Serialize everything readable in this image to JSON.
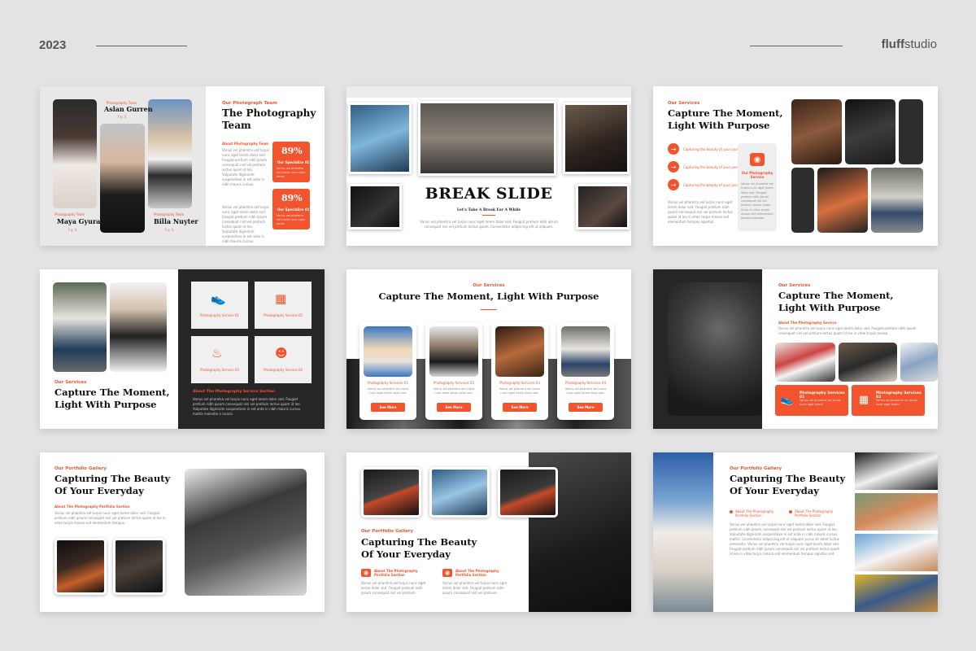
{
  "header": {
    "year": "2023",
    "brand_bold": "fluff",
    "brand_light": "studio"
  },
  "colors": {
    "accent": "#f2542d",
    "dark": "#262626",
    "background": "#e3e3e3"
  },
  "slide1": {
    "kicker": "Our Photograph Team",
    "title_l1": "The Photography",
    "title_l2": "Team",
    "about": "About Photography Team",
    "body": "Varius vel pharetra vel turpis nunc eget lorem dolor sed. Feugiat pretium nibh ipsum consequat nisl vel pretium lectus quam id leo. Vulputate dignissim suspendisse in est ante in nibh mauris cursus.",
    "stat1": {
      "value": "89%",
      "label": "Our Specialize 01",
      "text": "Varius vel pharetra vel turpis nunc eget lorem"
    },
    "stat2": {
      "value": "89%",
      "label": "Our Specialize 01",
      "text": "Varius vel pharetra vel turpis nunc eget lorem"
    },
    "member_top": {
      "role": "Photography Team",
      "name": "Aslan Gurren"
    },
    "member_left": {
      "role": "Photography Team",
      "name": "Maya Gyura"
    },
    "member_right": {
      "role": "Photography Team",
      "name": "Billa Nuyter"
    },
    "social": "f ◎ 𝕏"
  },
  "slide2": {
    "title": "BREAK SLIDE",
    "subtitle": "Let's Take A Break For A While",
    "body": "Varius vel pharetra vel turpis nunc eget lorem dolor sed. Feugiat pretium nibh ipsum consequat nisl vel pretium lectus quam. Consectetur adipiscing elit ut aliquam."
  },
  "slide3": {
    "kicker": "Our Services",
    "title_l1": "Capture The Moment,",
    "title_l2": "Light With Purpose",
    "items": [
      "Capturing the beauty of your journey",
      "Capturing the beauty of your journey",
      "Capturing the beauty of your journey"
    ],
    "service_label": "Our Photography Service",
    "body": "Varius vel pharetra vel turpis nunc eget lorem dolor sed. Feugiat pretium nibh ipsum consequat nisl vel pretium lectus quam id leo in vitae turpis massa sed elementum tempus egestas."
  },
  "slide4": {
    "kicker": "Our Services",
    "title_l1": "Capture The Moment,",
    "title_l2": "Light With Purpose",
    "services": [
      "Photography Service 01",
      "Photography Service 02",
      "Photography Service 03",
      "Photography Service 04"
    ],
    "section_title": "About The Photography Service Section",
    "body": "Varius vel pharetra vel turpis nunc eget lorem dolor sed. Feugiat pretium nibh ipsum consequat nisl vel pretium lectus quam id leo. Vulputate dignissim suspendisse in est ante in nibh mauris cursus mattis molestie a iaculis."
  },
  "slide5": {
    "kicker": "Our Services",
    "title": "Capture The Moment, Light With Purpose",
    "cards": [
      {
        "label": "Photography Services 01",
        "text": "Varius vel pharetra vel turpis nunc eget lorem dolor sed.",
        "button": "See More"
      },
      {
        "label": "Photography Services 02",
        "text": "Varius vel pharetra vel turpis nunc eget lorem dolor sed.",
        "button": "See More"
      },
      {
        "label": "Photography Services 03",
        "text": "Varius vel pharetra vel turpis nunc eget lorem dolor sed.",
        "button": "See More"
      },
      {
        "label": "Photography Services 04",
        "text": "Varius vel pharetra vel turpis nunc eget lorem dolor sed.",
        "button": "See More"
      }
    ]
  },
  "slide6": {
    "kicker": "Our Services",
    "title_l1": "Capture The Moment,",
    "title_l2": "Light With Purpose",
    "about": "About The Photography Service",
    "body": "Varius vel pharetra vel turpis nunc eget lorem dolor sed. Feugiat pretium nibh ipsum consequat nisl vel pretium lectus quam id leo in vitae turpis massa.",
    "service1": {
      "label": "Photography Services 01",
      "text": "Varius vel pharetra vel turpis nunc eget lorem"
    },
    "service2": {
      "label": "Photography Services 02",
      "text": "Varius vel pharetra vel turpis nunc eget lorem"
    }
  },
  "slide7": {
    "kicker": "Our Portfolio Gallery",
    "title_l1": "Capturing The Beauty",
    "title_l2": "Of Your Everyday",
    "about": "About The Photography Portfolio Section",
    "body": "Varius vel pharetra vel turpis nunc eget lorem dolor sed. Feugiat pretium nibh ipsum consequat nisl vel pretium lectus quam id leo in vitae turpis massa sed elementum tempus."
  },
  "slide8": {
    "kicker": "Our Portfolio Gallery",
    "title_l1": "Capturing The Beauty",
    "title_l2": "Of Your Everyday",
    "item1": {
      "label": "About The Photography Portfolio Section",
      "text": "Varius vel pharetra vel turpis nunc eget lorem dolor sed. Feugiat pretium nibh ipsum consequat nisl vel pretium."
    },
    "item2": {
      "label": "About The Photography Portfolio Section",
      "text": "Varius vel pharetra vel turpis nunc eget lorem dolor sed. Feugiat pretium nibh ipsum consequat nisl vel pretium."
    }
  },
  "slide9": {
    "kicker": "Our Portfolio Gallery",
    "title_l1": "Capturing The Beauty",
    "title_l2": "Of Your Everyday",
    "item1": {
      "label": "About The Photography Portfolio Section"
    },
    "item2": {
      "label": "About The Photography Portfolio Section"
    },
    "body": "Varius vel pharetra vel turpis nunc eget lorem dolor sed. Feugiat pretium nibh ipsum consequat nisl vel pretium lectus quam id leo. Vulputate dignissim suspendisse in est ante in nibh mauris cursus mattis. Consectetur adipiscing elit ut aliquam purus sit amet luctus venenatis. Varius vel pharetra vel turpis nunc eget lorem dolor sed. Feugiat pretium nibh ipsum consequat nisl vel pretium lectus quam id leo in vitae turpis massa sed elementum tempus egestas sed."
  }
}
